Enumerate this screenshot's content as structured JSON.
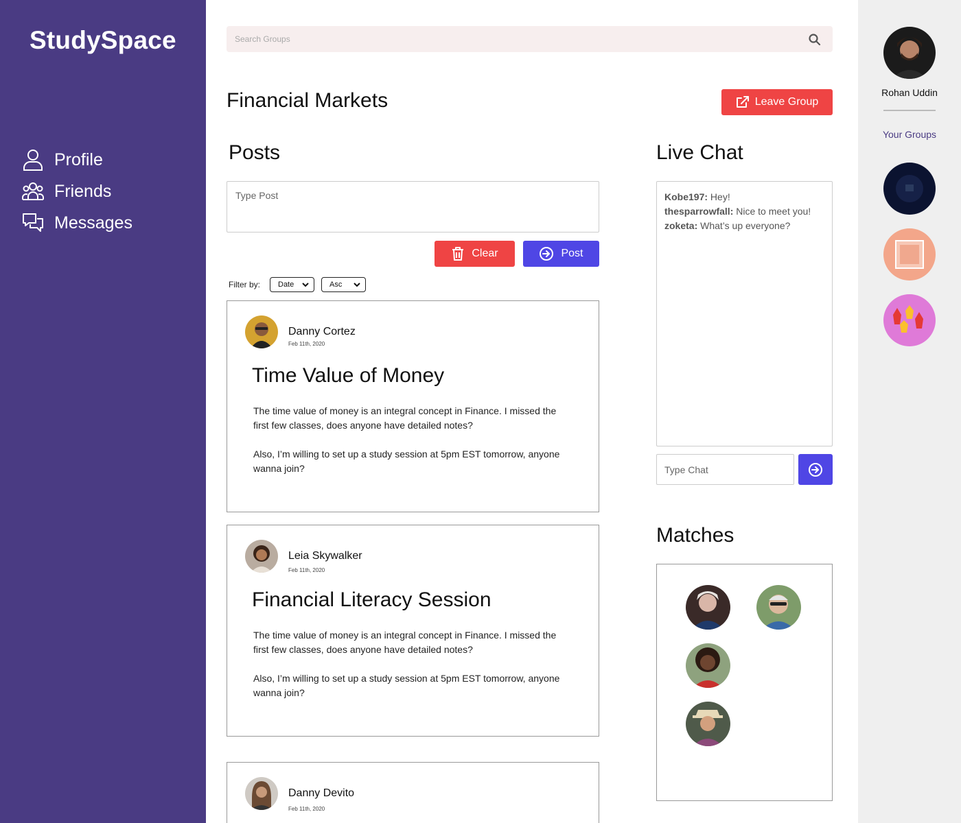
{
  "app": {
    "name": "StudySpace"
  },
  "nav": {
    "items": [
      {
        "label": "Profile",
        "icon": "user-icon"
      },
      {
        "label": "Friends",
        "icon": "users-icon"
      },
      {
        "label": "Messages",
        "icon": "chat-bubbles-icon"
      }
    ]
  },
  "search": {
    "placeholder": "Search Groups"
  },
  "group": {
    "title": "Financial Markets",
    "leave_label": "Leave Group"
  },
  "posts": {
    "heading": "Posts",
    "input_placeholder": "Type Post",
    "clear_label": "Clear",
    "post_label": "Post",
    "filter_label": "Filter by:",
    "sort_field": "Date",
    "sort_order": "Asc",
    "items": [
      {
        "author": "Danny Cortez",
        "date": "Feb 11th, 2020",
        "title": "Time Value of Money",
        "body": [
          "The time value of money is an integral concept in Finance. I missed the first few classes, does anyone have detailed notes?",
          "Also, I’m willing to set up a study session at 5pm EST tomorrow, anyone wanna join?"
        ]
      },
      {
        "author": "Leia Skywalker",
        "date": "Feb 11th, 2020",
        "title": "Financial Literacy Session",
        "body": [
          "The time value of money is an integral concept in Finance. I missed the first few classes, does anyone have detailed notes?",
          "Also, I’m willing to set up a study session at 5pm EST tomorrow, anyone wanna join?"
        ]
      },
      {
        "author": "Danny Devito",
        "date": "Feb 11th, 2020"
      }
    ]
  },
  "chat": {
    "heading": "Live Chat",
    "messages": [
      {
        "user": "Kobe197:",
        "text": "Hey!"
      },
      {
        "user": "thesparrowfall:",
        "text": "Nice to meet you!"
      },
      {
        "user": "zoketa:",
        "text": "What’s up everyone?"
      }
    ],
    "input_placeholder": "Type Chat"
  },
  "matches": {
    "heading": "Matches"
  },
  "user": {
    "name": "Rohan Uddin"
  },
  "your_groups": {
    "label": "Your Groups"
  },
  "colors": {
    "sidebar": "#4a3b83",
    "danger": "#ef4444",
    "primary": "#4f46e5",
    "search_bg": "#f7eeee",
    "right_panel": "#efefef"
  }
}
